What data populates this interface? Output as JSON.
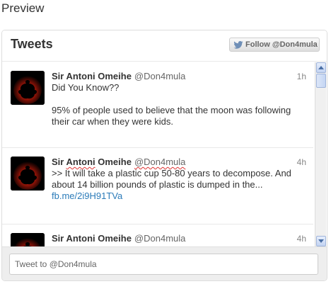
{
  "page": {
    "heading": "Preview"
  },
  "widget": {
    "title": "Tweets",
    "follow_label": "Follow @Don4mula"
  },
  "tweets": [
    {
      "name": "Sir Antoni Omeihe",
      "handle": "@Don4mula",
      "time": "1h",
      "line1": "Did You Know??",
      "line2": "95% of people used to believe that the moon was following their car when they were kids.",
      "link": ""
    },
    {
      "name_part1": "Sir ",
      "name_part2": "Antoni",
      "name_part3": " Omeihe",
      "handle": "@Don4mula",
      "time": "4h",
      "line1": ">> It will take a plastic cup 50-80 years to decompose. And about 14 billion pounds of plastic is dumped in the...",
      "link": "fb.me/2i9H91TVa"
    },
    {
      "name": "Sir Antoni Omeihe",
      "handle": "@Don4mula",
      "time": "4h"
    }
  ],
  "compose": {
    "placeholder": "Tweet to @Don4mula"
  },
  "colors": {
    "link": "#2b7bb9",
    "accent": "#4a6fa5"
  },
  "icons": {
    "follow": "twitter-bird-icon",
    "scroll_up": "arrow-up-icon",
    "scroll_down": "arrow-down-icon"
  }
}
